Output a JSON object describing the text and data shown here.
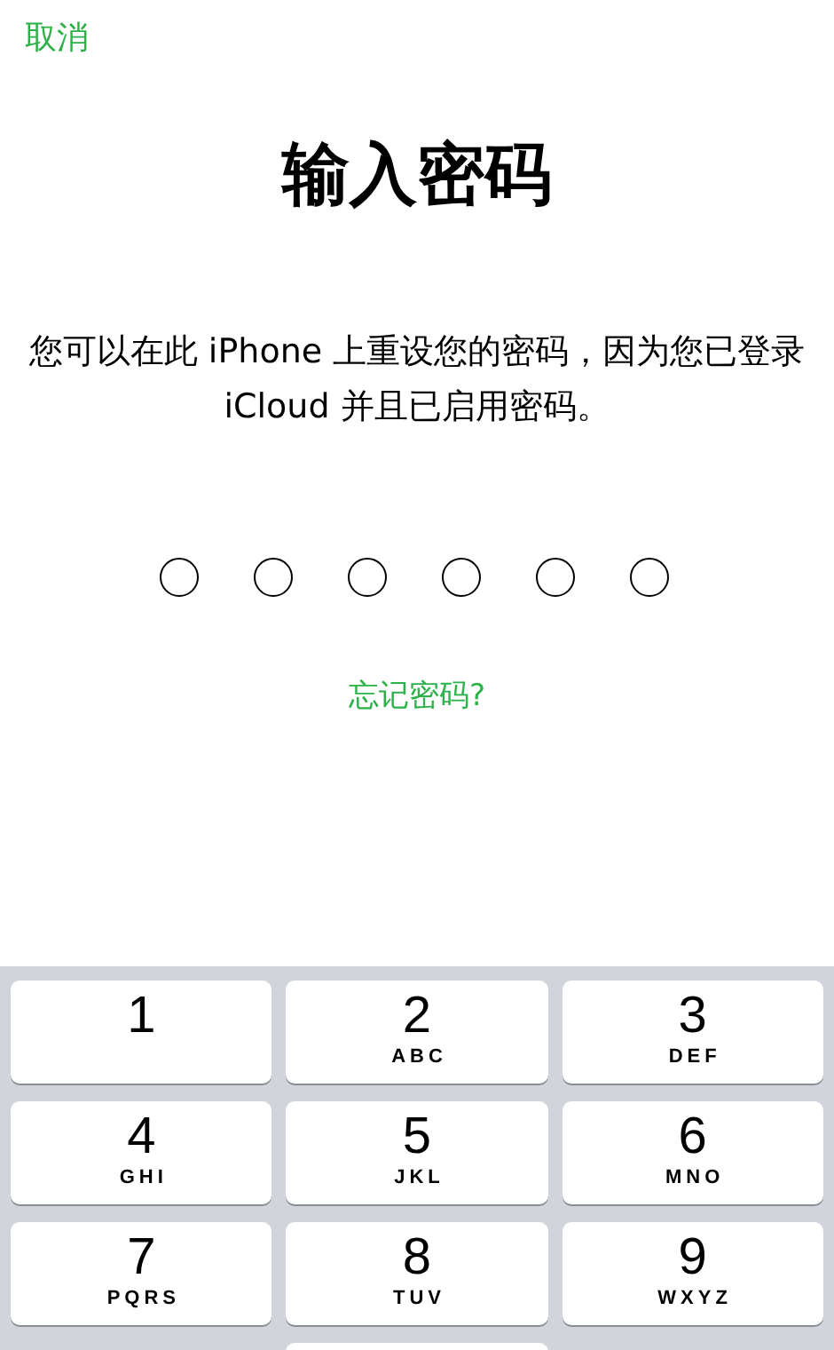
{
  "cancel": "取消",
  "title": "输入密码",
  "message": "您可以在此 iPhone 上重设您的密码，因为您已登录 iCloud 并且已启用密码。",
  "passcode": [
    {
      "filled": false
    },
    {
      "filled": false
    },
    {
      "filled": false
    },
    {
      "filled": false
    },
    {
      "filled": false
    },
    {
      "filled": false
    }
  ],
  "forgot": "忘记密码?",
  "keys": [
    {
      "digit": "1"
    },
    {
      "digit": "2",
      "letters": "ABC"
    },
    {
      "digit": "3",
      "letters": "DEF"
    },
    {
      "digit": "4",
      "letters": "GHI"
    },
    {
      "digit": "5",
      "letters": "JKL"
    },
    {
      "digit": "6",
      "letters": "MNO"
    },
    {
      "digit": "7",
      "letters": "PQRS"
    },
    {
      "digit": "8",
      "letters": "TUV"
    },
    {
      "digit": "9",
      "letters": "WXYZ"
    }
  ]
}
